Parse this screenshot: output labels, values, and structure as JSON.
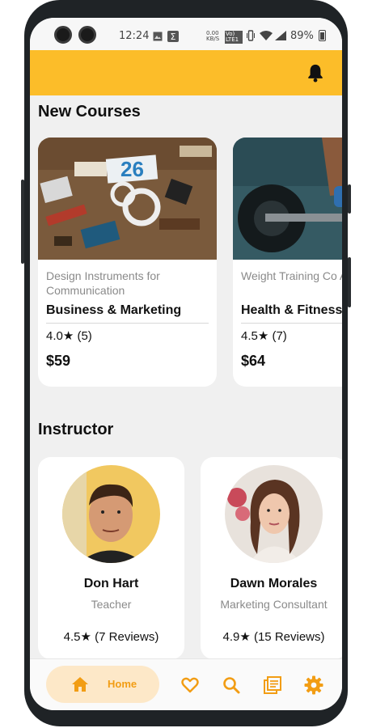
{
  "status_bar": {
    "time": "12:24",
    "speed": "0.00 KB/S",
    "volte": "Vo) LTE1",
    "battery": "89%"
  },
  "app_bar": {
    "notification_icon": "bell-icon",
    "color": "#fcbd29"
  },
  "courses": {
    "title": "New Courses",
    "items": [
      {
        "subtitle": "Design Instruments for Communication",
        "category": "Business & Marketing",
        "rating": "4.0",
        "reviews": "(5)",
        "price": "$59"
      },
      {
        "subtitle": "Weight Training Co Any Di",
        "category": "Health & Fitness",
        "rating": "4.5",
        "reviews": "(7)",
        "price": "$64"
      }
    ]
  },
  "instructors": {
    "title": "Instructor",
    "items": [
      {
        "name": "Don Hart",
        "role": "Teacher",
        "rating": "4.5",
        "reviews": "(7 Reviews)"
      },
      {
        "name": "Dawn Morales",
        "role": "Marketing Consultant",
        "rating": "4.9",
        "reviews": "(15 Reviews)"
      }
    ]
  },
  "bottom_nav": {
    "home_label": "Home",
    "accent_color": "#f29d14",
    "items": [
      "home-icon",
      "heart-icon",
      "search-icon",
      "library-icon",
      "gear-icon"
    ]
  },
  "derived": {
    "course_rating_0": "4.0★ (5)",
    "course_rating_1": "4.5★ (7)",
    "inst_rating_0": "4.5★ (7 Reviews)",
    "inst_rating_1": "4.9★ (15 Reviews)"
  }
}
